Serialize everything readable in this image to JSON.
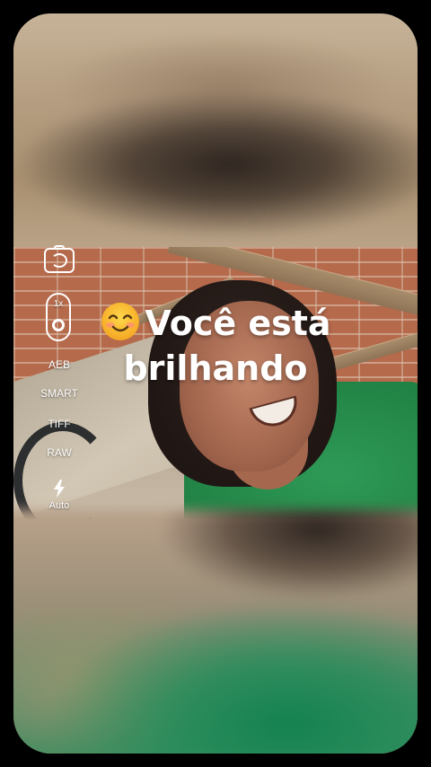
{
  "camera_controls": {
    "zoom_label": "1x",
    "modes": [
      "AEB",
      "SMART",
      "TIFF",
      "RAW"
    ],
    "flash_label": "Auto"
  },
  "caption": {
    "line1": "Você está",
    "line2": "brilhando",
    "emoji": "smiling-face-emoji"
  },
  "colors": {
    "background": "#000000",
    "shirt_green": "#238748",
    "brick": "#b56a4c"
  }
}
